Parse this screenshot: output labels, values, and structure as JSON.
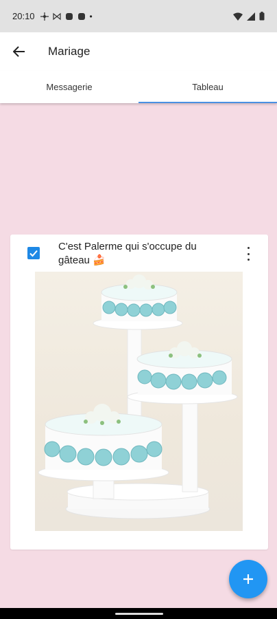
{
  "status_bar": {
    "time": "20:10",
    "notification_icons": [
      "fan-icon",
      "bowtie-icon",
      "app-icon",
      "app-icon"
    ],
    "dot": "•",
    "right_icons": [
      "wifi-icon",
      "signal-icon",
      "battery-icon"
    ]
  },
  "app_bar": {
    "title": "Mariage",
    "back_icon": "arrow-left-icon"
  },
  "tabs": [
    {
      "label": "Messagerie",
      "active": false
    },
    {
      "label": "Tableau",
      "active": true
    }
  ],
  "card": {
    "checked": true,
    "text": "C'est Palerme qui s'occupe du gâteau 🍰",
    "menu_icon": "more-vertical-icon",
    "image": "cake-photo"
  },
  "fab": {
    "icon": "plus-icon"
  },
  "colors": {
    "background": "#f5dbe4",
    "accent": "#2196f3",
    "tab_indicator": "#4a90e2"
  }
}
